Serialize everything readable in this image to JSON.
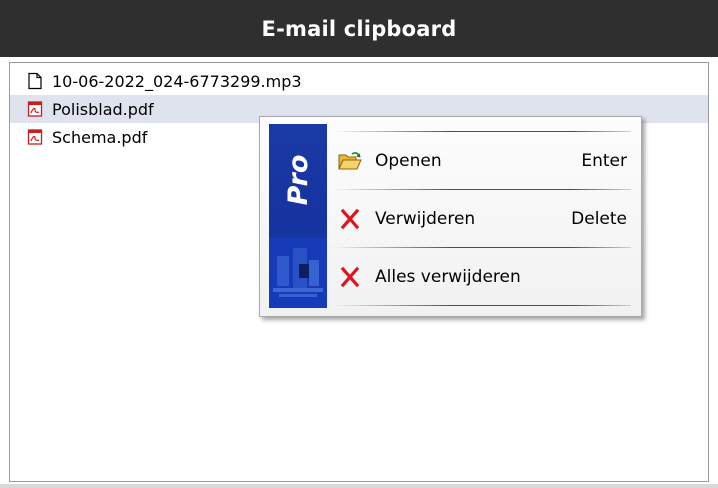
{
  "window": {
    "title": "E-mail clipboard"
  },
  "files": [
    {
      "name": "10-06-2022_024-6773299.mp3",
      "icon": "file-icon",
      "selected": false
    },
    {
      "name": "Polisblad.pdf",
      "icon": "pdf-icon",
      "selected": true
    },
    {
      "name": "Schema.pdf",
      "icon": "pdf-icon",
      "selected": false
    }
  ],
  "context_menu": {
    "side_banner": "Pro",
    "items": [
      {
        "label": "Openen",
        "shortcut": "Enter",
        "icon": "open-folder-icon"
      },
      {
        "label": "Verwijderen",
        "shortcut": "Delete",
        "icon": "delete-x-icon"
      },
      {
        "label": "Alles verwijderen",
        "shortcut": "",
        "icon": "delete-x-icon"
      }
    ]
  },
  "colors": {
    "titlebar": "#2f2f2f",
    "selection": "#dfe3ee",
    "banner": "#1a3aa6",
    "delete_x": "#e0141e"
  }
}
